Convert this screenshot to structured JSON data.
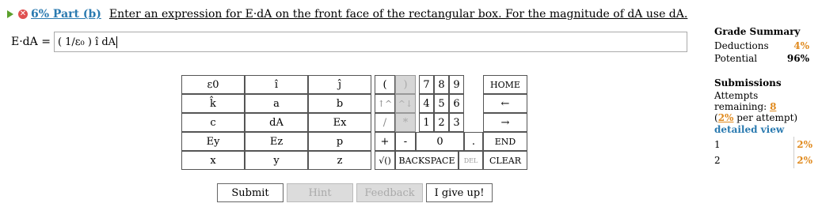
{
  "header": {
    "part_label": "6% Part (b)",
    "prompt": "Enter an expression for E·dA on the front face of the rectangular box. For the magnitude of dA use dA."
  },
  "answer": {
    "label": "E·dA =",
    "value": "( 1/ε₀ ) î dA"
  },
  "grade_summary": {
    "title": "Grade Summary",
    "deductions_label": "Deductions",
    "deductions_value": "4%",
    "potential_label": "Potential",
    "potential_value": "96%"
  },
  "submissions": {
    "title": "Submissions",
    "attempts_text": "Attempts remaining:",
    "attempts_value": "8",
    "penalty_value": "2%",
    "penalty_text": "per attempt)",
    "paren_open": "(",
    "detailed_view": "detailed view",
    "rows": [
      {
        "num": "1",
        "val": "2%"
      },
      {
        "num": "2",
        "val": "2%"
      }
    ]
  },
  "keypad": {
    "vars": [
      [
        "ε0",
        "î",
        "ĵ"
      ],
      [
        "k̂",
        "a",
        "b"
      ],
      [
        "c",
        "dA",
        "Ex"
      ],
      [
        "Ey",
        "Ez",
        "p"
      ],
      [
        "x",
        "y",
        "z"
      ]
    ],
    "ops": {
      "open_paren": "(",
      "close_paren": ")",
      "up_caret": "↑^",
      "down_caret": "^↓",
      "slash": "/",
      "star": "*",
      "plus": "+",
      "minus": "-",
      "sqrt": "√()",
      "backspace": "BACKSPACE",
      "del": "DEL"
    },
    "digits": [
      "7",
      "8",
      "9",
      "4",
      "5",
      "6",
      "1",
      "2",
      "3"
    ],
    "zero": "0",
    "dot": ".",
    "nav": {
      "home": "HOME",
      "left": "←",
      "right": "→",
      "end": "END",
      "clear": "CLEAR"
    }
  },
  "buttons": {
    "submit": "Submit",
    "hint": "Hint",
    "feedback": "Feedback",
    "give_up": "I give up!"
  }
}
